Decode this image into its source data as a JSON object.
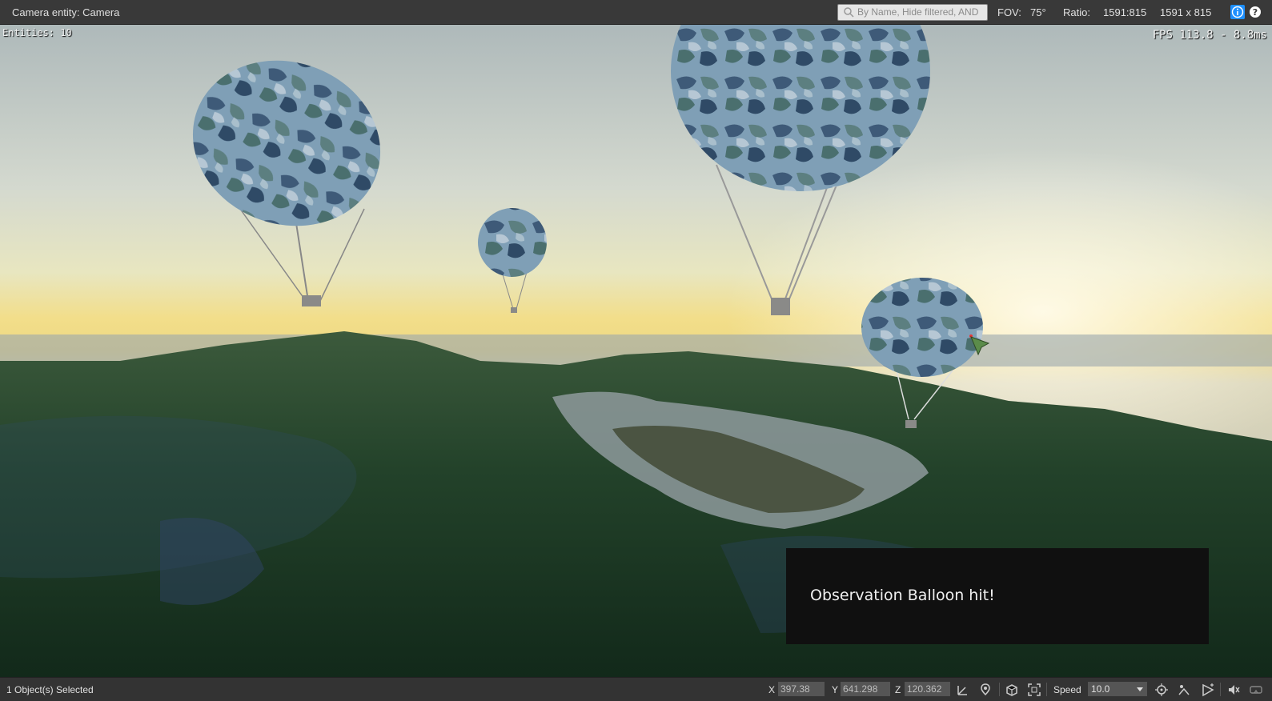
{
  "topbar": {
    "title": "Camera entity: Camera",
    "search_placeholder": "By Name, Hide filtered, AND",
    "fov_label": "FOV:",
    "fov_value": "75°",
    "ratio_label": "Ratio:",
    "ratio_value": "1591:815",
    "resolution": "1591 x 815",
    "icons": [
      "search-icon",
      "info-icon",
      "help-icon"
    ]
  },
  "viewport": {
    "entities_text": "Entities: 10",
    "fps_text": "FPS 113.8 - 8.8ms",
    "notification": "Observation Balloon hit!"
  },
  "statusbar": {
    "selection": "1 Object(s) Selected",
    "x_label": "X",
    "x_value": "397.38",
    "y_label": "Y",
    "y_value": "641.298",
    "z_label": "Z",
    "z_value": "120.362",
    "speed_label": "Speed",
    "speed_value": "10.0",
    "icons": [
      "axis-constraint-icon",
      "snap-to-terrain-icon",
      "object-snap-icon",
      "grid-snap-icon",
      "goto-selection-icon",
      "follow-terrain-icon",
      "ai-physics-icon",
      "mute-icon",
      "vr-headset-icon"
    ]
  },
  "colors": {
    "topbar_bg": "#393939",
    "statusbar_bg": "#333333",
    "info_blue": "#1e90ff",
    "notification_bg": "#101010"
  }
}
